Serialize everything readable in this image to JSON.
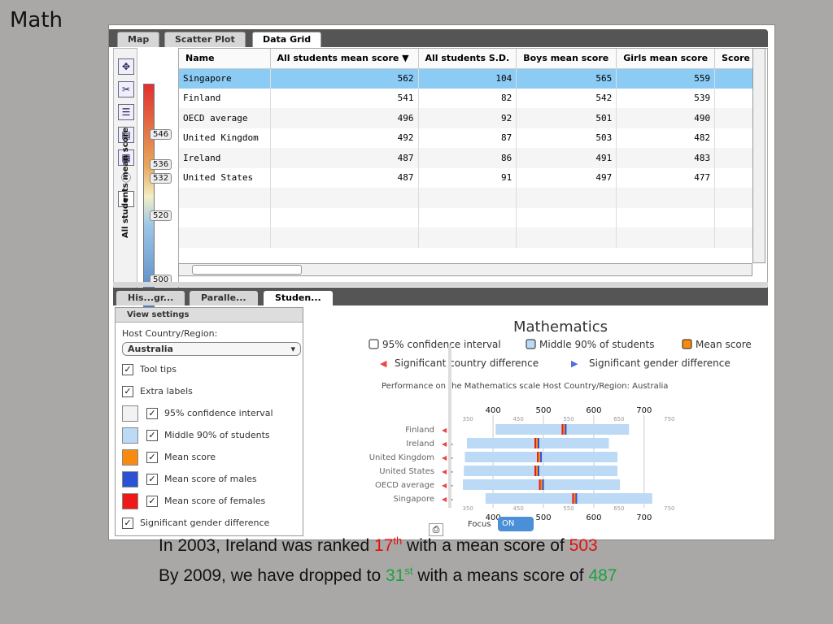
{
  "slide": {
    "title": "Math",
    "line1_pre": "In 2003, Ireland was ranked ",
    "line1_rank": "17",
    "line1_sup": "th",
    "line1_mid": " with a mean score of ",
    "line1_score": "503",
    "line2_pre": "By 2009, we have dropped to ",
    "line2_rank": "31",
    "line2_sup": "st",
    "line2_mid": " with a means score of ",
    "line2_score": "487"
  },
  "top_tabs": [
    "Map",
    "Scatter Plot",
    "Data Grid"
  ],
  "active_top_tab": "Data Grid",
  "slider": {
    "label": "All students mean score",
    "tags": [
      "546",
      "536",
      "532",
      "520",
      "500"
    ]
  },
  "grid": {
    "columns": [
      "Name",
      "All students mean score ▼",
      "All students S.D.",
      "Boys mean score",
      "Girls mean score",
      "Score c"
    ],
    "rows": [
      [
        "Singapore",
        "562",
        "104",
        "565",
        "559"
      ],
      [
        "Finland",
        "541",
        "82",
        "542",
        "539"
      ],
      [
        "OECD average",
        "496",
        "92",
        "501",
        "490"
      ],
      [
        "United Kingdom",
        "492",
        "87",
        "503",
        "482"
      ],
      [
        "Ireland",
        "487",
        "86",
        "491",
        "483"
      ],
      [
        "United States",
        "487",
        "91",
        "497",
        "477"
      ]
    ]
  },
  "bottom_tabs": [
    "His...gr...",
    "Paralle...",
    "Studen..."
  ],
  "settings": {
    "header": "View settings",
    "host_label": "Host Country/Region:",
    "host_value": "Australia",
    "checks": [
      "Tool tips",
      "Extra labels"
    ],
    "legend_checks": [
      "95% confidence interval",
      "Middle 90% of students",
      "Mean score",
      "Mean score of males",
      "Mean score of females"
    ],
    "gender_check": "Significant gender difference"
  },
  "colors": {
    "ci": "#f2f2f2",
    "middle90": "#bcd9f5",
    "mean": "#f78b12",
    "males": "#2c52d4",
    "females": "#ee1a1a"
  },
  "chart": {
    "title": "Mathematics",
    "legend": [
      "95% confidence interval",
      "Middle 90% of students",
      "Mean score"
    ],
    "legend2": [
      "Significant country difference",
      "Significant gender difference"
    ],
    "subtitle": "Performance on the Mathematics scale    Host Country/Region: Australia",
    "focus_label": "Focus",
    "focus_value": "ON",
    "major_ticks": [
      "400",
      "500",
      "600",
      "700"
    ],
    "minor_ticks": [
      "350",
      "450",
      "550",
      "650",
      "750"
    ]
  },
  "chart_data": {
    "type": "bar",
    "title": "Mathematics",
    "categories": [
      "Finland",
      "Ireland",
      "United Kingdom",
      "United States",
      "OECD average",
      "Singapore"
    ],
    "x_range": [
      340,
      760
    ],
    "series": [
      {
        "name": "Middle 90% of students",
        "low": [
          405,
          348,
          344,
          342,
          340,
          385
        ],
        "high": [
          670,
          630,
          647,
          647,
          652,
          716
        ]
      },
      {
        "name": "Mean score",
        "values": [
          541,
          487,
          492,
          487,
          496,
          562
        ]
      }
    ]
  }
}
